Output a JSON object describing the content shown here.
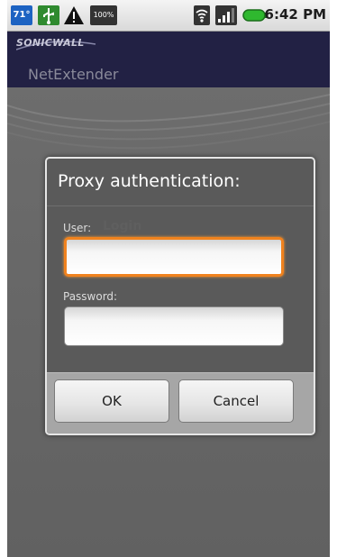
{
  "status_bar": {
    "temperature": "71°",
    "battery_badge": "100%",
    "time": "6:42 PM"
  },
  "title_bar": {
    "logo_text": "SONICWALL",
    "app_title": "NetExtender"
  },
  "dialog": {
    "title": "Proxy authentication:",
    "user_label": "User:",
    "user_hint": "Login",
    "user_value": "",
    "password_label": "Password:",
    "password_value": "",
    "ok_label": "OK",
    "cancel_label": "Cancel"
  },
  "colors": {
    "title_bar_bg": "#222144",
    "focus_accent": "#f0821e",
    "dialog_bg": "#5a5a5a"
  },
  "icons": [
    "temperature-icon",
    "usb-icon",
    "warning-icon",
    "battery-full-icon",
    "wifi-icon",
    "signal-icon",
    "battery-icon"
  ]
}
